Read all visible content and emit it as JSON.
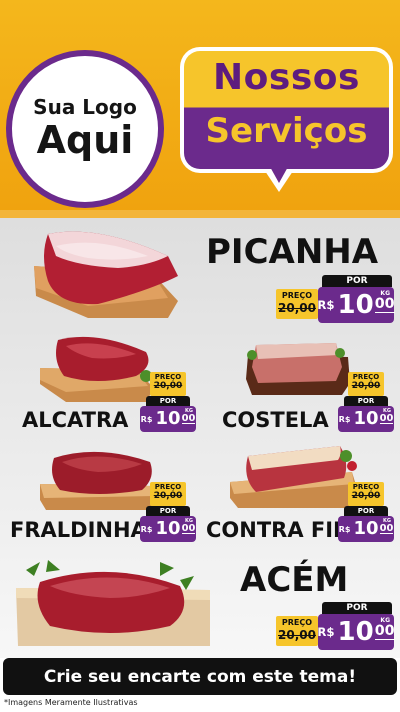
{
  "header": {
    "logo_line1": "Sua Logo",
    "logo_line2": "Aqui",
    "title_line1": "Nossos",
    "title_line2": "Serviços"
  },
  "products": [
    {
      "name": "PICANHA",
      "preco_label": "PREÇO",
      "old_price": "20,00",
      "por_label": "POR",
      "currency": "R$",
      "value_int": "10",
      "value_cents": "00",
      "unit": "KG"
    },
    {
      "name": "ALCATRA",
      "preco_label": "PREÇO",
      "old_price": "20,00",
      "por_label": "POR",
      "currency": "R$",
      "value_int": "10",
      "value_cents": "00",
      "unit": "KG"
    },
    {
      "name": "COSTELA",
      "preco_label": "PREÇO",
      "old_price": "20,00",
      "por_label": "POR",
      "currency": "R$",
      "value_int": "10",
      "value_cents": "00",
      "unit": "KG"
    },
    {
      "name": "FRALDINHA",
      "preco_label": "PREÇO",
      "old_price": "20,00",
      "por_label": "POR",
      "currency": "R$",
      "value_int": "10",
      "value_cents": "00",
      "unit": "KG"
    },
    {
      "name": "CONTRA FILÉ",
      "preco_label": "PREÇO",
      "old_price": "20,00",
      "por_label": "POR",
      "currency": "R$",
      "value_int": "10",
      "value_cents": "00",
      "unit": "KG"
    },
    {
      "name": "ACÉM",
      "preco_label": "PREÇO",
      "old_price": "20,00",
      "por_label": "POR",
      "currency": "R$",
      "value_int": "10",
      "value_cents": "00",
      "unit": "KG"
    }
  ],
  "footer": {
    "cta": "Crie seu encarte com este tema!",
    "disclaimer": "*Imagens Meramente Ilustrativas"
  },
  "colors": {
    "header_yellow": "#f4b71c",
    "purple": "#6b2a8c",
    "tag_yellow": "#f6c52b",
    "black": "#111111"
  }
}
